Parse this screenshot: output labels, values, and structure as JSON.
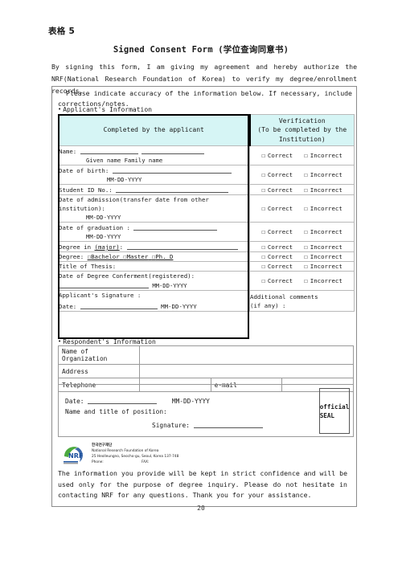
{
  "document": {
    "form_number": "表格 5",
    "title": "Signed Consent Form  (学位查询同意书)",
    "intro": "By signing this form, I am giving my agreement and hereby authorize the NRF(National Research Foundation of Korea) to verify my degree/enrollment records.",
    "notice": "Please indicate accuracy of the information below. If necessary, include corrections/notes.",
    "page_number": "20"
  },
  "applicant_section": {
    "label": "Applicant's Information",
    "bullet": "•",
    "header_left": "Completed by the applicant",
    "header_right_line1": "Verification",
    "header_right_line2": "(To be completed by the",
    "header_right_line3": "Institution)",
    "verify_correct": "Correct",
    "verify_incorrect": "Incorrect",
    "checkbox_glyph": "☐",
    "rows": [
      {
        "label": "Name:",
        "sub": "Given name                  Family name",
        "date_hint": ""
      },
      {
        "label": "Date of birth:",
        "sub": "MM-DD-YYYY",
        "date_hint": ""
      },
      {
        "label": "Student ID No.:",
        "sub": "",
        "date_hint": ""
      },
      {
        "label": "Date of admission(transfer date from other institution):",
        "sub": "MM-DD-YYYY",
        "date_hint": ""
      },
      {
        "label": "Date of graduation :",
        "sub": "MM-DD-YYYY",
        "date_hint": ""
      },
      {
        "label": "Degree in (major):",
        "sub": "",
        "date_hint": ""
      },
      {
        "label": "Degree:",
        "sub": "",
        "date_hint": "",
        "options": [
          "Bachelor",
          "Master",
          "Ph. D"
        ]
      },
      {
        "label": "Title of Thesis:",
        "sub": "",
        "date_hint": ""
      },
      {
        "label": "Date of Degree Conferment(registered):",
        "sub": "",
        "date_hint": "MM-DD-YYYY"
      }
    ],
    "signature_row": {
      "signature_label": "Applicant's Signature :",
      "date_label": "Date:",
      "date_hint": "MM-DD-YYYY",
      "comments_line1": "Additional comments",
      "comments_line2": "(if any) :"
    }
  },
  "respondent_section": {
    "label": "Respondent's Information",
    "bullet": "•",
    "rows": [
      {
        "key": "Name of Organization",
        "value": ""
      },
      {
        "key": "Address",
        "value": ""
      }
    ],
    "telephone_label": "Telephone",
    "telephone_value": "",
    "email_label": "e-mail",
    "email_value": "",
    "signature_block": {
      "date_label": "Date:",
      "date_hint": "MM-DD-YYYY",
      "name_title_label": "Name and title of position:",
      "signature_label": "Signature:",
      "seal_text": "official SEAL"
    }
  },
  "nrf_footer": {
    "logo_text": "NRF",
    "korean_name": "한국연구재단",
    "english_name": "National Research Foundation of Korea",
    "address": "25 Heolleungno, Seocho-gu, Seoul, Korea 137-748",
    "phone_label": "Phone:",
    "fax_label": "FAX:",
    "closing_note": "The information you provide will be kept in strict confidence and will be used only for the purpose of degree inquiry. Please do not hesitate in contacting NRF for any questions. Thank you for your assistance."
  },
  "colors": {
    "header_fill": "#d6f5f5",
    "thick_border": "#000000",
    "thin_border": "#b9b9b9",
    "logo_blue": "#1a4f9c",
    "logo_green": "#4caa3f"
  }
}
